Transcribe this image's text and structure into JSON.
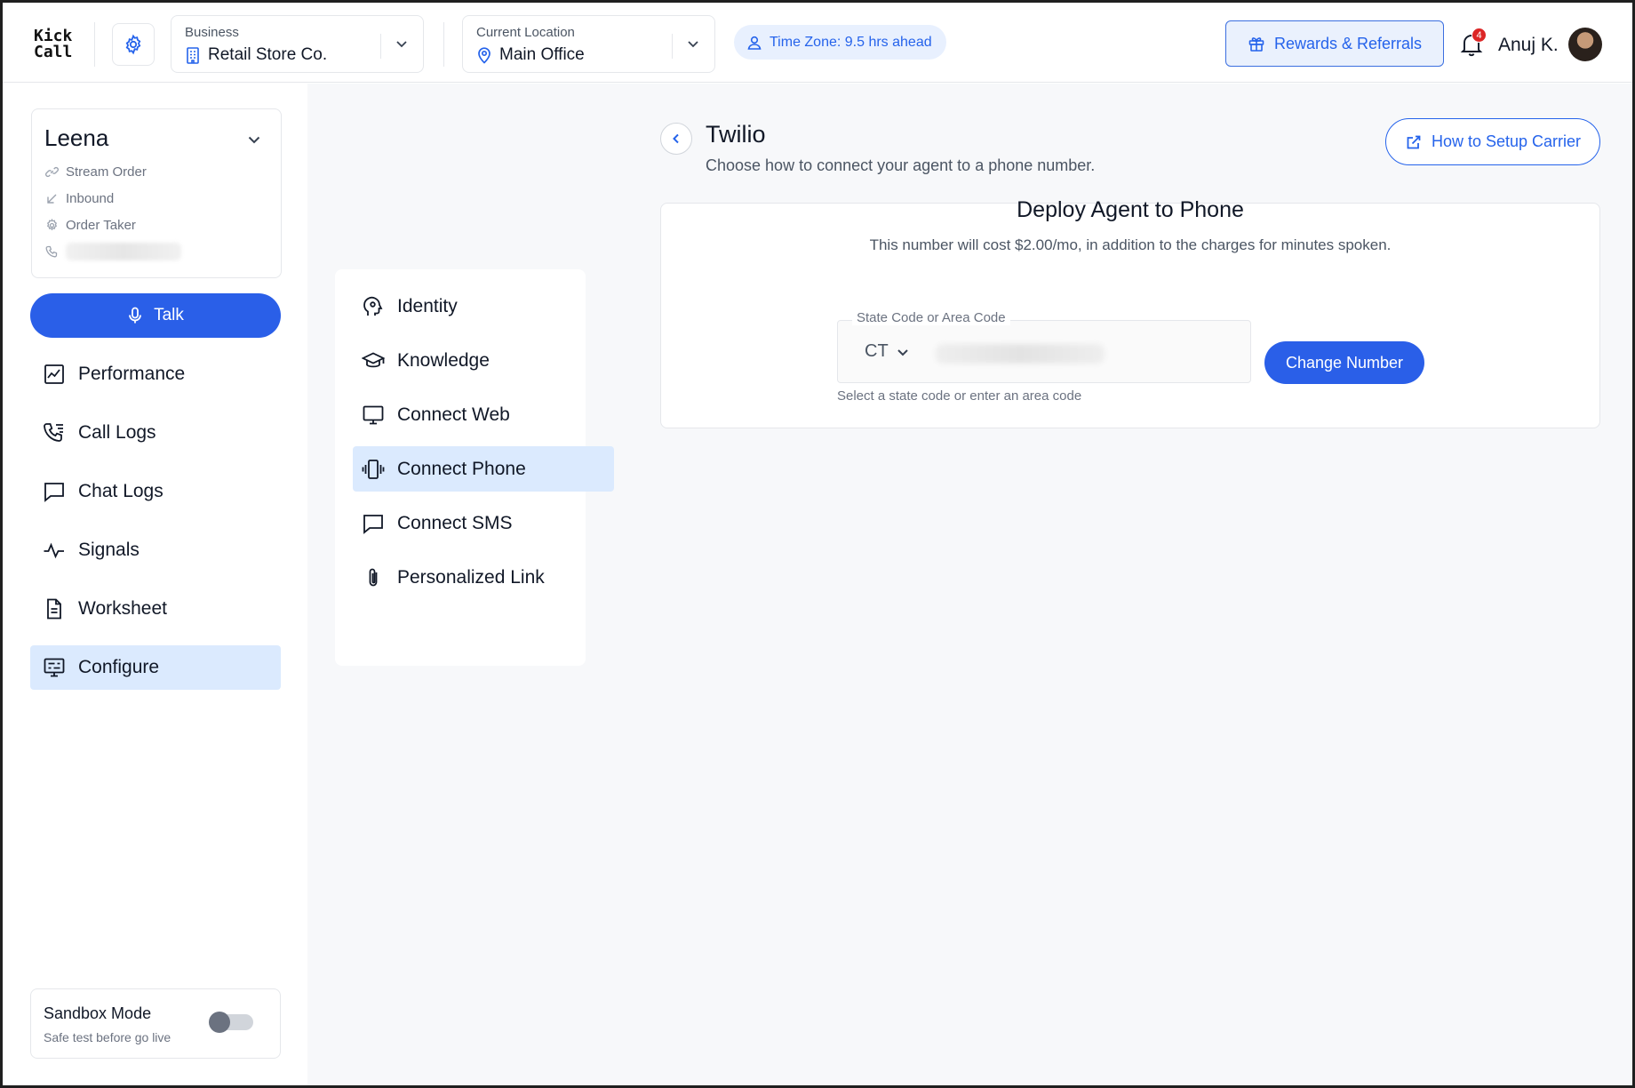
{
  "app": {
    "logo_line1": "Kick",
    "logo_line2": "Call"
  },
  "header": {
    "business": {
      "caption": "Business",
      "value": "Retail Store Co."
    },
    "location": {
      "caption": "Current Location",
      "value": "Main Office"
    },
    "timezone": "Time Zone: 9.5 hrs ahead",
    "rewards_label": "Rewards & Referrals",
    "notifications_count": "4",
    "user_name": "Anuj K."
  },
  "agent": {
    "name": "Leena",
    "meta": [
      "Stream Order",
      "Inbound",
      "Order Taker"
    ]
  },
  "sidebar": {
    "talk_label": "Talk",
    "items": [
      {
        "label": "Performance",
        "icon": "chart-icon"
      },
      {
        "label": "Call Logs",
        "icon": "phone-list-icon"
      },
      {
        "label": "Chat Logs",
        "icon": "chat-icon"
      },
      {
        "label": "Signals",
        "icon": "activity-icon"
      },
      {
        "label": "Worksheet",
        "icon": "document-icon"
      },
      {
        "label": "Configure",
        "icon": "configure-icon",
        "active": true
      }
    ],
    "sandbox": {
      "title": "Sandbox Mode",
      "subtitle": "Safe test before go live",
      "enabled": false
    }
  },
  "subnav": {
    "items": [
      {
        "label": "Identity"
      },
      {
        "label": "Knowledge"
      },
      {
        "label": "Connect Web"
      },
      {
        "label": "Connect Phone",
        "active": true
      },
      {
        "label": "Connect SMS"
      },
      {
        "label": "Personalized Link"
      }
    ]
  },
  "page": {
    "title": "Twilio",
    "subtitle": "Choose how to connect your agent to a phone number.",
    "setup_label": "How to Setup Carrier"
  },
  "deploy": {
    "title": "Deploy Agent to Phone",
    "subtitle": "This number will cost $2.00/mo, in addition to the charges for minutes spoken.",
    "field_label": "State Code or Area Code",
    "state_value": "CT",
    "help_text": "Select a state code or enter an area code",
    "change_label": "Change Number"
  },
  "colors": {
    "accent": "#2a5fe8",
    "active_bg": "#dbeafe",
    "badge": "#dc2626"
  }
}
